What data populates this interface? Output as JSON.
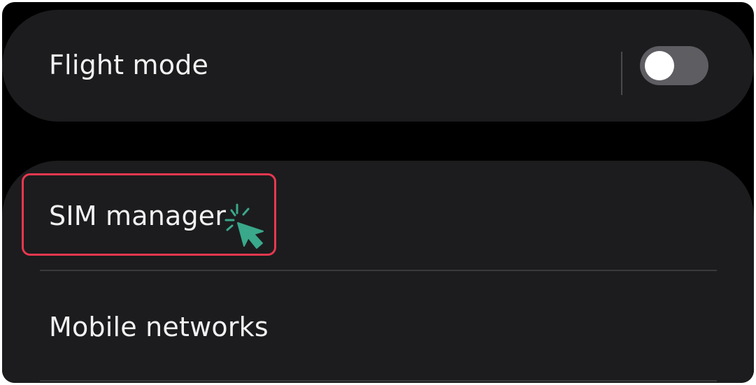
{
  "settings": {
    "flight_mode": {
      "label": "Flight mode",
      "toggle_on": false
    },
    "items": [
      {
        "label": "SIM manager"
      },
      {
        "label": "Mobile networks"
      }
    ]
  },
  "colors": {
    "background": "#000000",
    "card": "#1c1c1e",
    "text": "#f2f2f2",
    "toggle_track_off": "#5e5d62",
    "toggle_knob": "#ffffff",
    "highlight": "#e8384f",
    "cursor": "#3aa88a"
  },
  "icons": {
    "cursor": "click-cursor-icon"
  }
}
